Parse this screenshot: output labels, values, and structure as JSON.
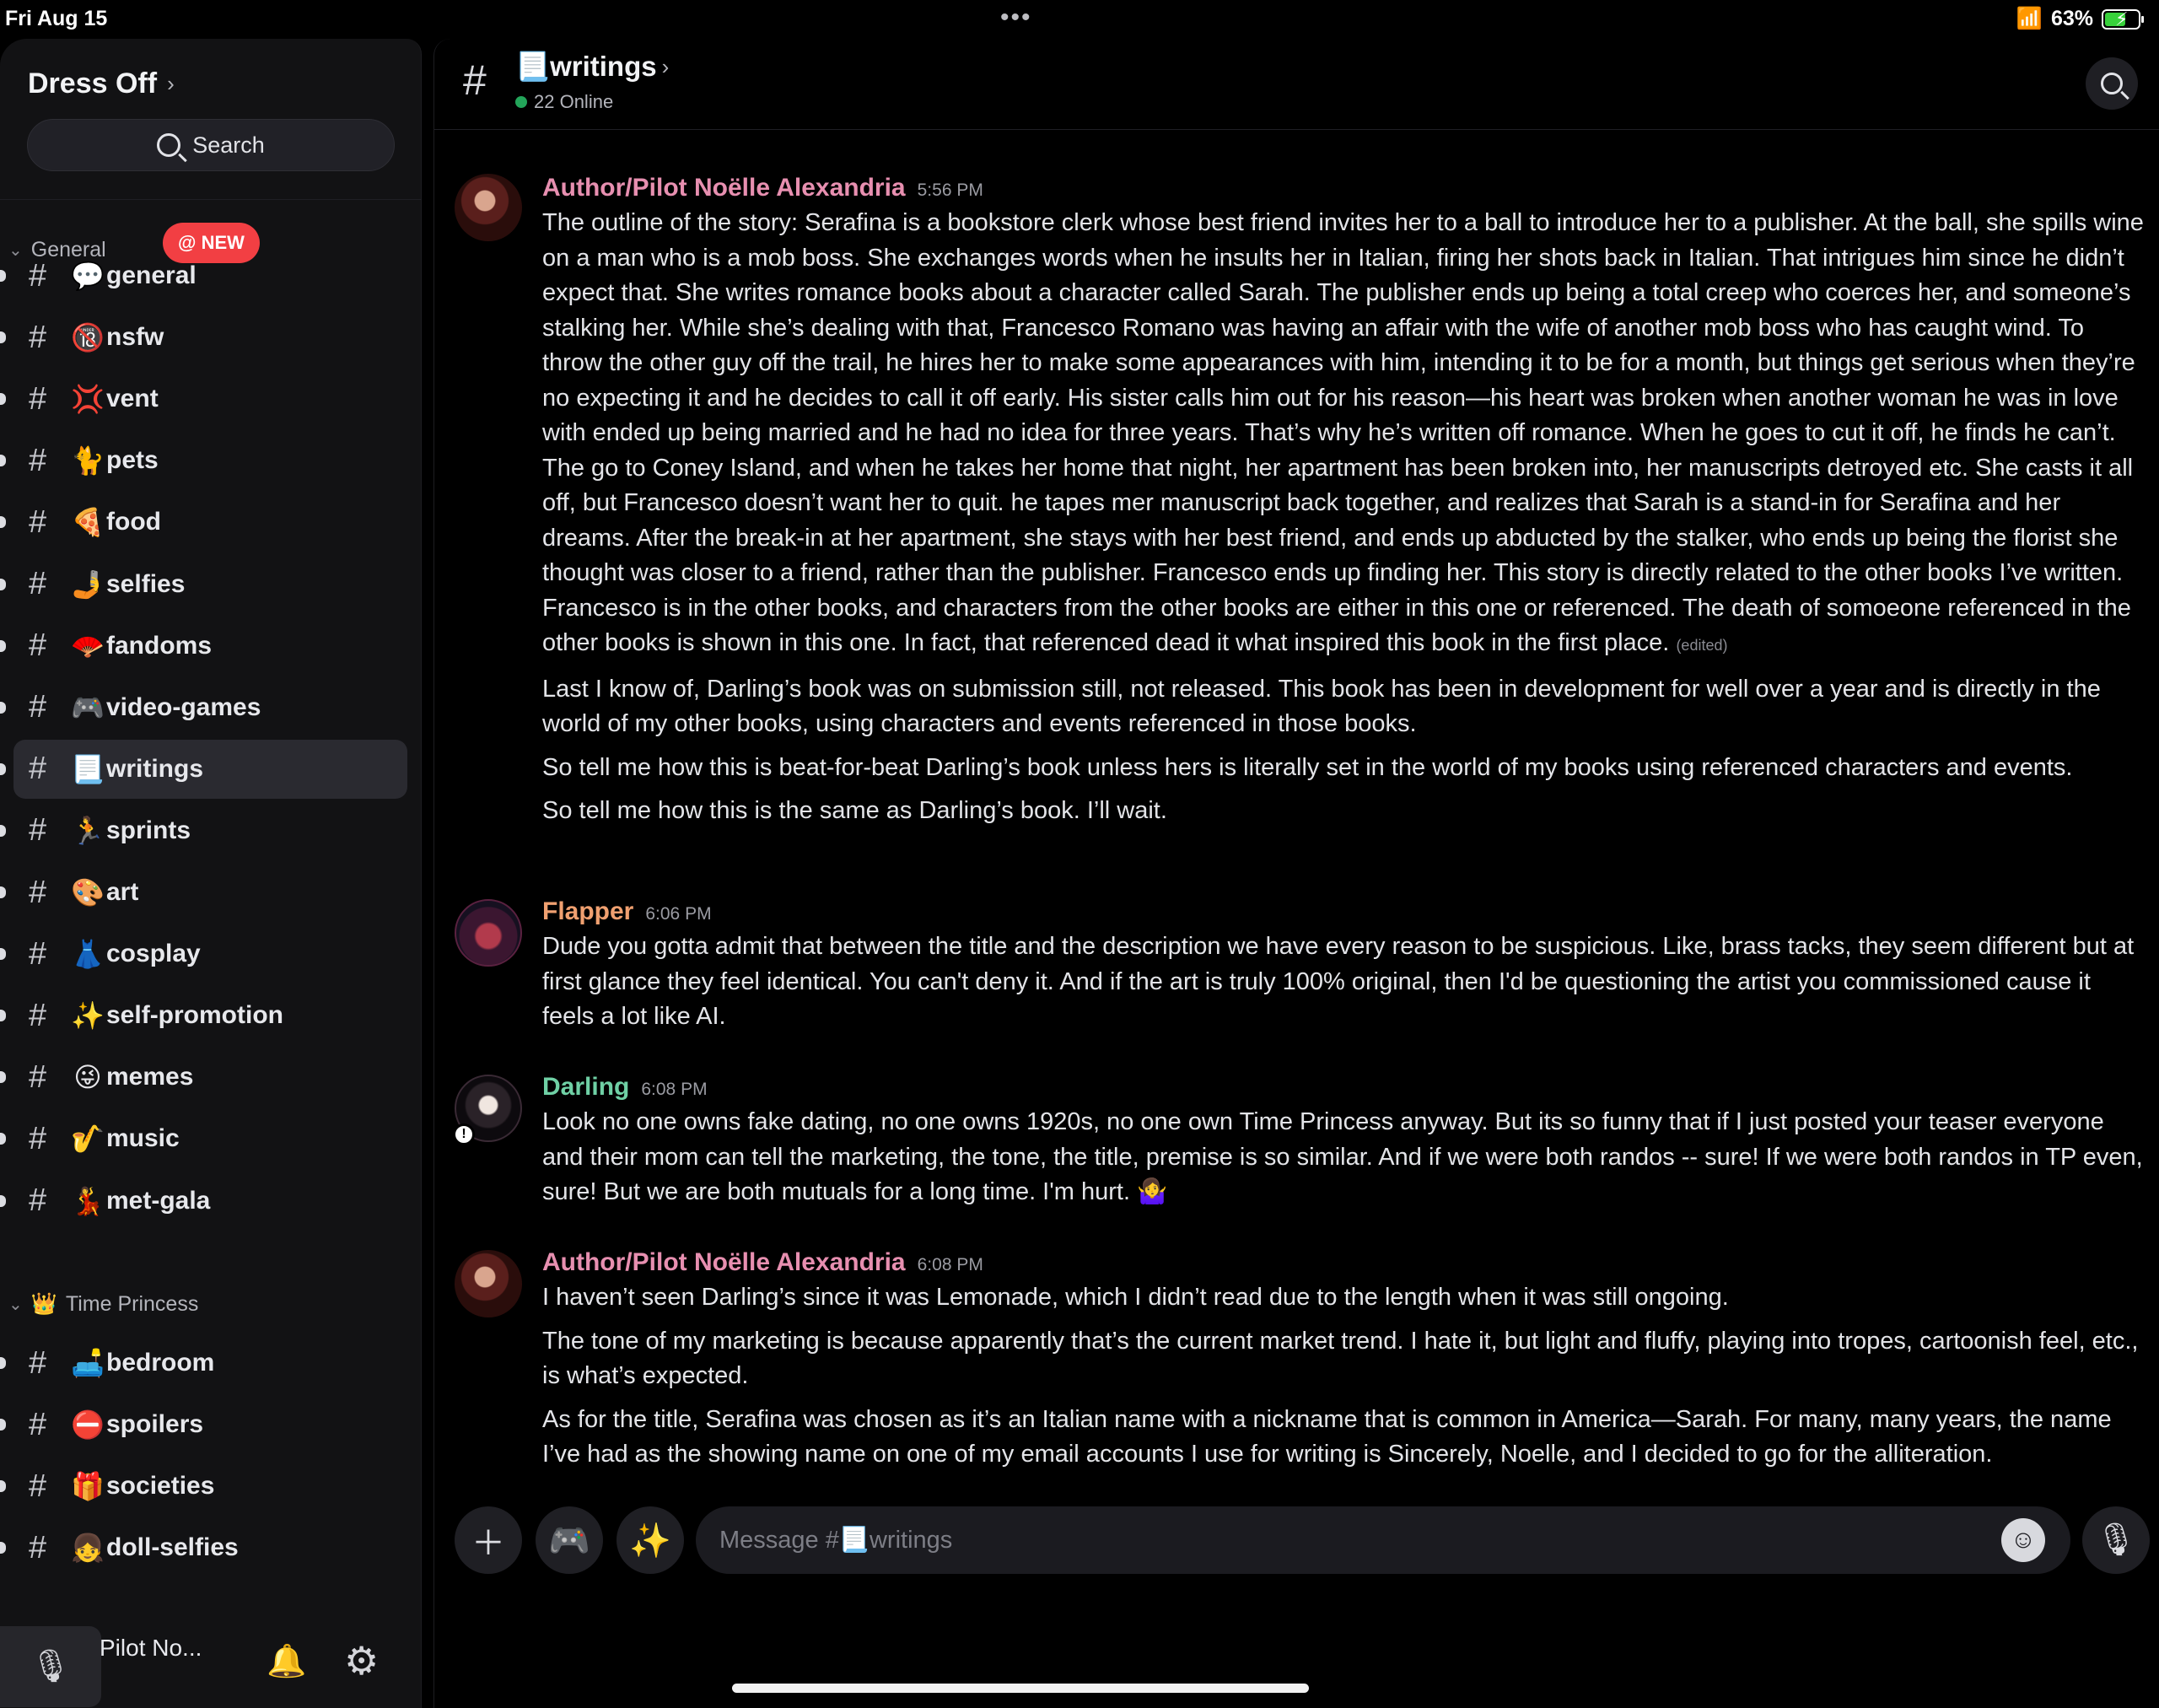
{
  "status_bar": {
    "time": "Fri Aug 15",
    "dots": "•••",
    "battery": "63%",
    "battery_level": 0.63
  },
  "colors": {
    "accent_pink": "#e78fb0",
    "accent_orange": "#f0a070",
    "accent_green": "#6fd0a5",
    "online": "#23a55a",
    "badge_red": "#f23f43"
  },
  "sidebar": {
    "server_name": "Dress Off",
    "search_label": "Search",
    "categories": [
      {
        "label": "General",
        "badge": "@ NEW"
      },
      {
        "label": "Time Princess",
        "emoji": "👑"
      }
    ],
    "channels": [
      {
        "emoji": "💬",
        "name": "general"
      },
      {
        "emoji": "🔞",
        "name": "nsfw"
      },
      {
        "emoji": "💢",
        "name": "vent"
      },
      {
        "emoji": "🐈",
        "name": "pets"
      },
      {
        "emoji": "🍕",
        "name": "food"
      },
      {
        "emoji": "🤳",
        "name": "selfies"
      },
      {
        "emoji": "🪭",
        "name": "fandoms"
      },
      {
        "emoji": "🎮",
        "name": "video-games"
      },
      {
        "emoji": "📃",
        "name": "writings"
      },
      {
        "emoji": "🏃",
        "name": "sprints"
      },
      {
        "emoji": "🎨",
        "name": "art"
      },
      {
        "emoji": "👗",
        "name": "cosplay"
      },
      {
        "emoji": "✨",
        "name": "self-promotion"
      },
      {
        "emoji": "😜",
        "name": "memes"
      },
      {
        "emoji": "🎷",
        "name": "music"
      },
      {
        "emoji": "💃",
        "name": "met-gala"
      },
      {
        "emoji": "🛋️",
        "name": "bedroom"
      },
      {
        "emoji": "⛔",
        "name": "spoilers"
      },
      {
        "emoji": "🎁",
        "name": "societies"
      },
      {
        "emoji": "👧",
        "name": "doll-selfies"
      }
    ],
    "user_name": "Pilot No..."
  },
  "channel_header": {
    "hash": "#",
    "title": "📃writings",
    "online": "22 Online"
  },
  "messages": [
    {
      "author": "Author/Pilot Noëlle Alexandria",
      "time": "5:56 PM",
      "paragraphs": [
        "The outline of the story: Serafina is a bookstore clerk whose best friend invites her to a ball to introduce her to a publisher.  At the ball, she spills wine on a man who is a mob boss.  She exchanges words when he insults her in Italian, firing her shots back in Italian. That intrigues him since he didn’t expect that. She writes romance books about a character called Sarah.  The publisher ends up being a total creep who coerces her, and someone’s stalking her.  While she’s dealing with that, Francesco Romano was having an affair with the wife of another mob boss who has caught wind.  To throw the other guy off the trail, he hires her to make some appearances with him, intending it to be for a month, but things get serious when they’re no expecting it and he decides to call it off early.  His sister calls him out for his reason—his heart was broken when another woman he was in love with ended up being married and he had no idea for three years.  That’s why he’s written off romance.  When he goes to cut it off, he finds he can’t.  The go to Coney Island, and when he takes her home that night, her apartment has been broken into, her manuscripts detroyed etc. She casts it all off, but Francesco doesn’t want her to quit.  he tapes mer manuscript back together, and realizes that Sarah is a stand-in for Serafina and her dreams.  After the break-in at her apartment, she stays with her best friend, and ends up abducted by the stalker, who ends up being the florist she thought was closer to a friend, rather than the publisher.  Francesco ends up finding her.  This story is directly related to the other books I’ve written. Francesco is in the other books, and characters from the other books are either in this one or referenced. The death of somoeone referenced in the other books is shown in this one.  In fact, that referenced dead it what inspired this book in the first place.",
        "Last I know of, Darling’s book was on submission still, not released. This book has been in development for well over a year and is directly in the world of my other books, using characters and events referenced in those books.",
        "So tell me how this is beat-for-beat Darling’s book unless hers is literally set in the world of my books using referenced characters and events.",
        "So tell me how this is the same as Darling’s book.  I’ll wait."
      ],
      "edited_label": "(edited)"
    },
    {
      "author": "Flapper",
      "time": "6:06 PM",
      "paragraphs": [
        "Dude you gotta admit that between the title and the description we have every reason to be suspicious. Like, brass tacks, they seem different but at first glance they feel identical. You can't deny it. And if the art is truly 100% original, then I'd be questioning the artist you commissioned cause it feels a lot like AI."
      ]
    },
    {
      "author": "Darling",
      "time": "6:08 PM",
      "paragraphs": [
        "Look no one owns fake dating, no one owns 1920s, no one own Time Princess anyway. But its so funny that if I just posted your teaser everyone and their mom can tell the marketing, the tone, the title, premise is so similar. And if we were both randos -- sure! If we were both randos in TP even, sure! But we are both mutuals for a long time. I'm hurt. 🤷‍♀️"
      ]
    },
    {
      "author": "Author/Pilot Noëlle Alexandria",
      "time": "6:08 PM",
      "paragraphs": [
        "I haven’t seen Darling’s since it was Lemonade, which I didn’t read due to the length when it was still ongoing.",
        "The tone of my marketing is because apparently that’s the current market trend.  I hate it, but light and fluffy, playing into tropes, cartoonish feel, etc., is what’s expected.",
        "As for the title, Serafina was chosen as it’s an Italian name with a nickname that is common in America—Sarah.  For many, many years, the name I’ve had as the showing name on one of my email accounts I use for writing is Sincerely, Noelle, and I decided to go for the alliteration."
      ]
    }
  ],
  "composer": {
    "placeholder": "Message #📃writings"
  }
}
